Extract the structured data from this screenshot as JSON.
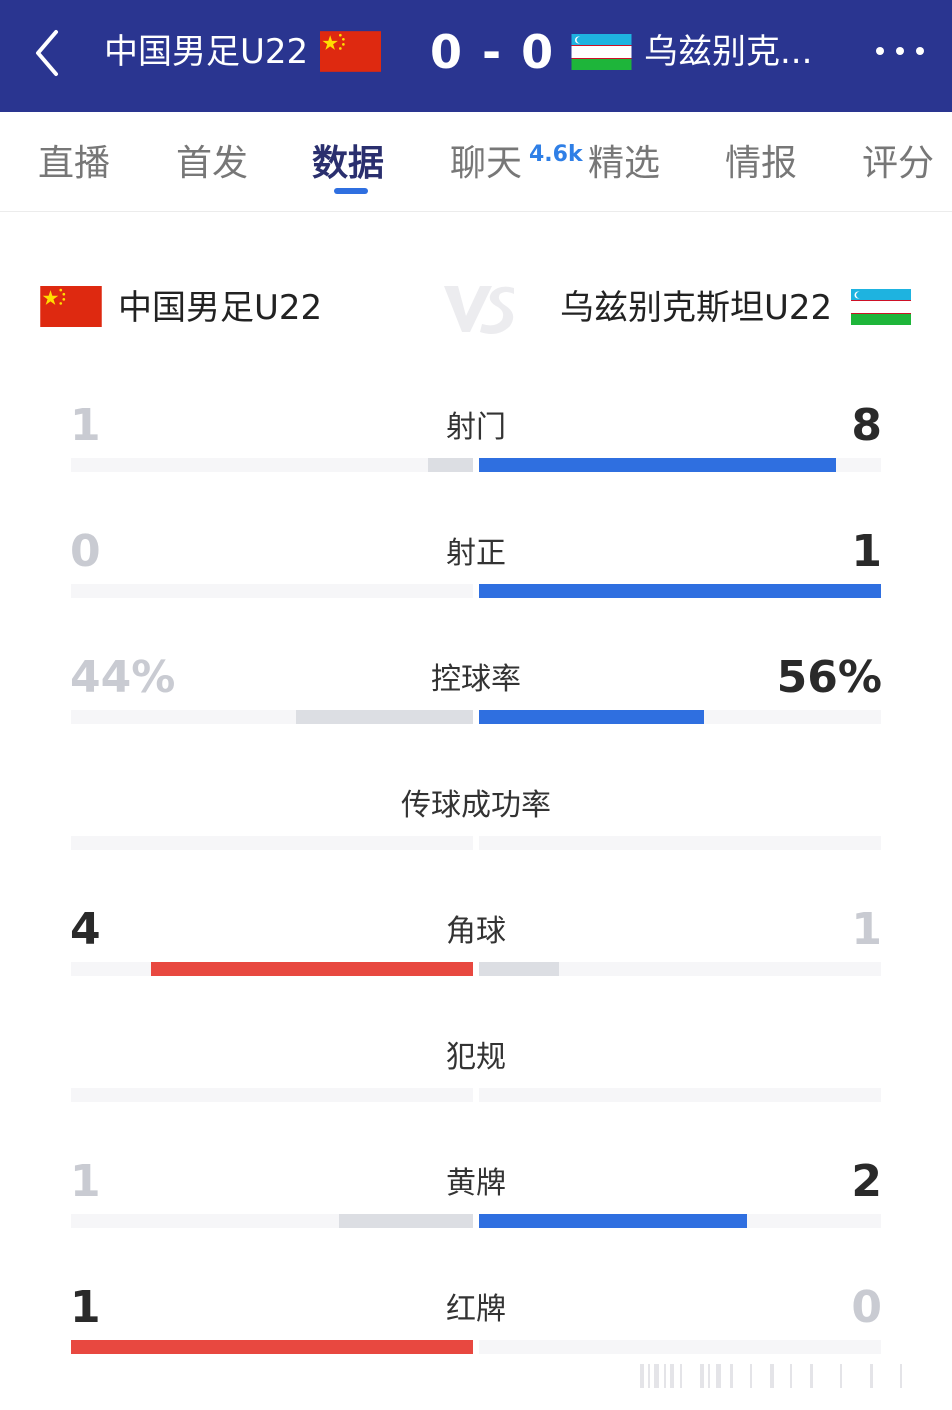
{
  "header": {
    "home_name": "中国男足U22",
    "score": "0 - 0",
    "away_name": "乌兹别克..."
  },
  "tabs": [
    {
      "label": "直播"
    },
    {
      "label": "首发"
    },
    {
      "label": "数据"
    },
    {
      "label": "聊天"
    },
    {
      "label": "精选"
    },
    {
      "label": "情报"
    },
    {
      "label": "评分"
    }
  ],
  "active_tab": "数据",
  "chat_badge": "4.6k",
  "teams": {
    "home": "中国男足U22",
    "away": "乌兹别克斯坦U22"
  },
  "colors": {
    "header_bg": "#2a3590",
    "away_bar": "#2f6fe0",
    "home_bar": "#e84840",
    "trailing_bar": "#dcdee3"
  },
  "stats": [
    {
      "label": "射门",
      "home": "1",
      "away": "8",
      "home_share": 0.111,
      "away_share": 0.889,
      "leader": "away"
    },
    {
      "label": "射正",
      "home": "0",
      "away": "1",
      "home_share": 0.0,
      "away_share": 1.0,
      "leader": "away"
    },
    {
      "label": "控球率",
      "home": "44%",
      "away": "56%",
      "home_share": 0.44,
      "away_share": 0.56,
      "leader": "away"
    },
    {
      "label": "传球成功率",
      "home": "",
      "away": "",
      "home_share": 0,
      "away_share": 0,
      "leader": "none"
    },
    {
      "label": "角球",
      "home": "4",
      "away": "1",
      "home_share": 0.8,
      "away_share": 0.2,
      "leader": "home"
    },
    {
      "label": "犯规",
      "home": "",
      "away": "",
      "home_share": 0,
      "away_share": 0,
      "leader": "none"
    },
    {
      "label": "黄牌",
      "home": "1",
      "away": "2",
      "home_share": 0.333,
      "away_share": 0.667,
      "leader": "away"
    },
    {
      "label": "红牌",
      "home": "1",
      "away": "0",
      "home_share": 1.0,
      "away_share": 0.0,
      "leader": "home"
    }
  ]
}
